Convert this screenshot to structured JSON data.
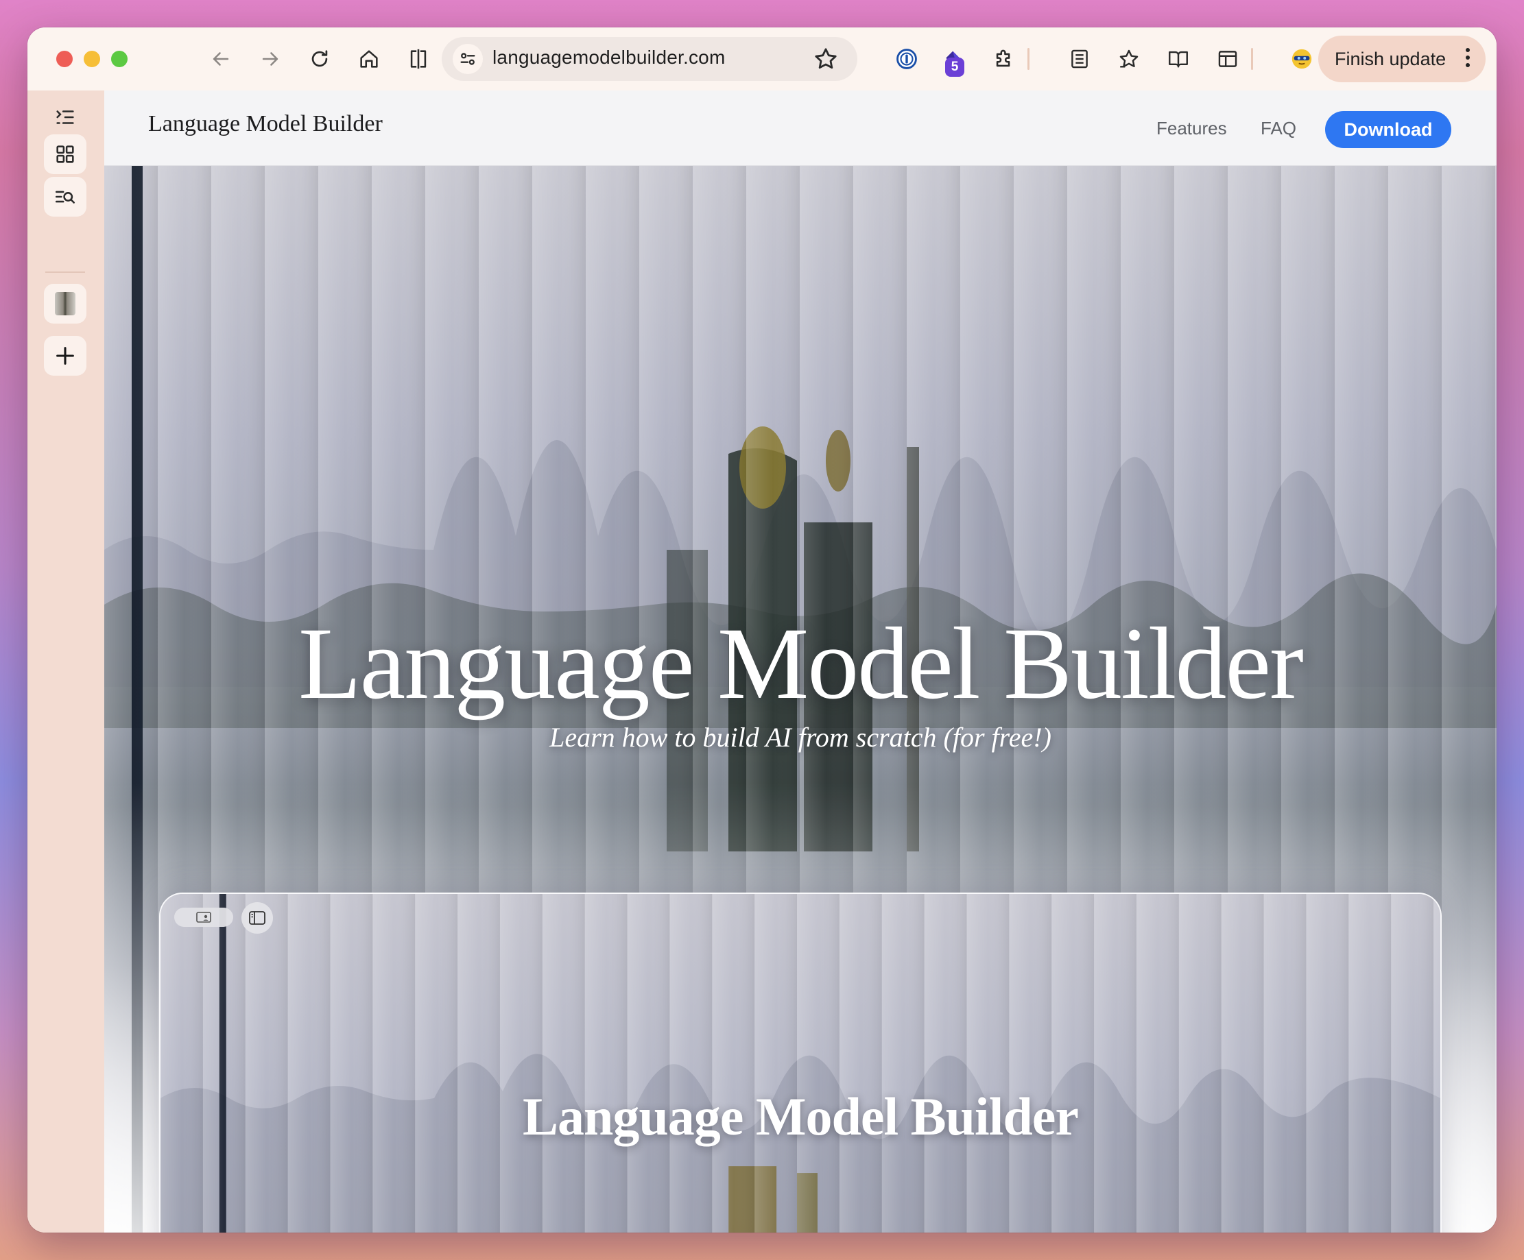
{
  "browser": {
    "url": "languagemodelbuilder.com",
    "extension_badge": "5",
    "finish_update_label": "Finish update",
    "icons": [
      "back-icon",
      "forward-icon",
      "reload-icon",
      "home-icon",
      "split-view-icon",
      "site-settings-icon",
      "bookmark-star-icon",
      "password-manager-icon",
      "extension-icon",
      "puzzle-icon",
      "reading-list-icon",
      "favorites-icon",
      "reader-mode-icon",
      "tab-layout-icon",
      "profile-avatar-icon",
      "more-vert-icon"
    ]
  },
  "sidebar": {
    "icons": [
      "expand-sidebar-icon",
      "tab-grid-icon",
      "tab-search-icon",
      "tab-thumbnail",
      "add-icon"
    ]
  },
  "site": {
    "logo": "Language Model Builder",
    "nav": {
      "features": "Features",
      "faq": "FAQ",
      "download": "Download"
    },
    "hero": {
      "title": "Language Model Builder",
      "subtitle": "Learn how to build AI from scratch (for free!)"
    },
    "preview": {
      "title": "Language Model Builder"
    }
  },
  "colors": {
    "download_button": "#2e77f2",
    "finish_update_bg": "#f3d6c9",
    "sidebar_bg": "#f3dcd2"
  }
}
